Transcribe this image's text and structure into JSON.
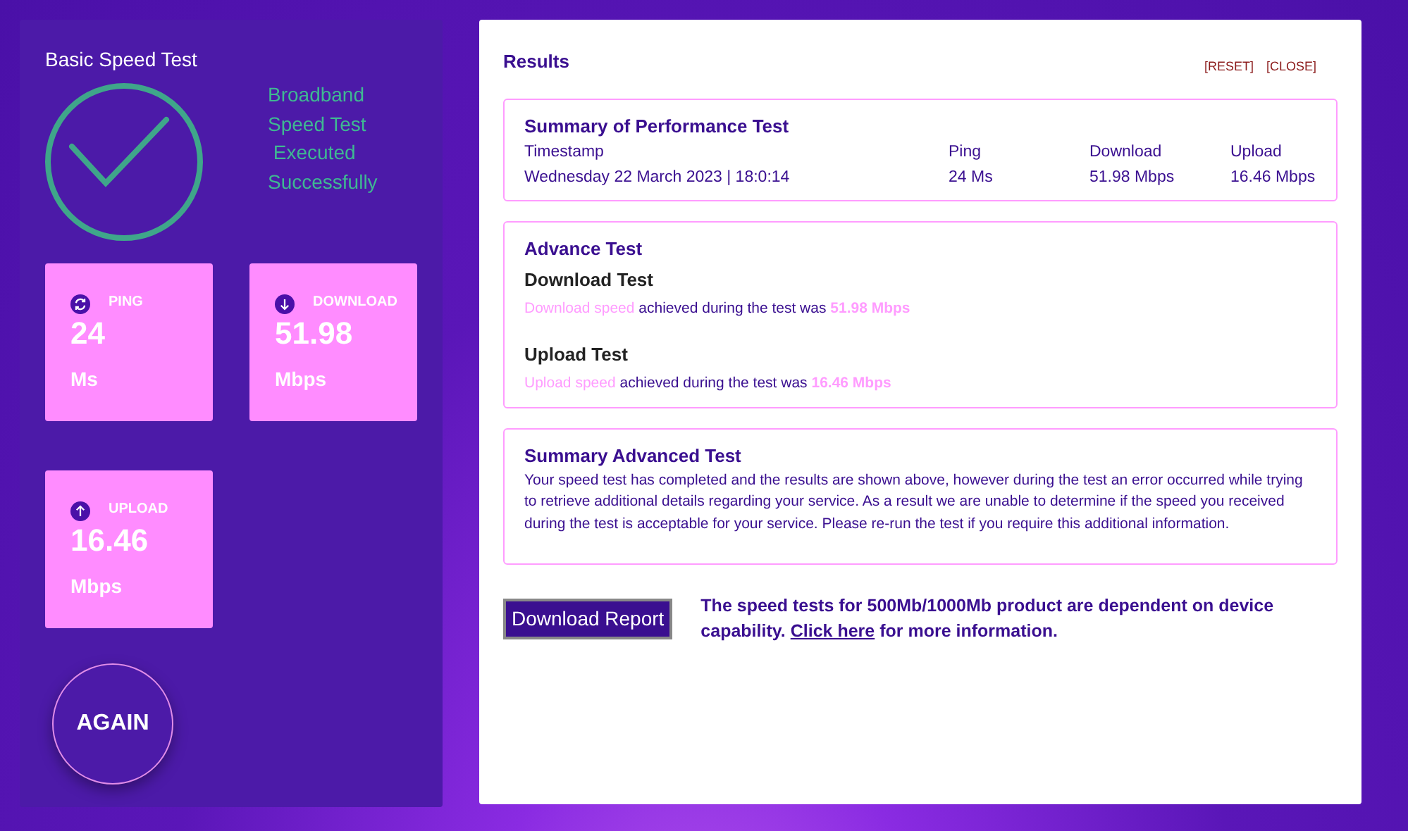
{
  "basic": {
    "title": "Basic Speed Test",
    "status_lines": [
      "Broadband",
      "Speed Test",
      " Executed",
      "Successfully"
    ],
    "stats": [
      {
        "kind": "ping",
        "label": "PING",
        "value": "24",
        "unit": "Ms"
      },
      {
        "kind": "download",
        "label": "DOWNLOAD",
        "value": "51.98",
        "unit": "Mbps"
      },
      {
        "kind": "upload",
        "label": "UPLOAD",
        "value": "16.46",
        "unit": "Mbps"
      }
    ],
    "again_button": "AGAIN"
  },
  "results": {
    "title": "Results",
    "links": [
      "[RESET]",
      "[CLOSE]"
    ],
    "summary": {
      "title": "Summary of Performance Test",
      "columns": [
        "Timestamp",
        "Ping",
        "Download",
        "Upload"
      ],
      "values": [
        "Wednesday 22 March 2023 | 18:0:14",
        "24 Ms",
        "51.98 Mbps",
        "16.46 Mbps"
      ]
    },
    "advance": {
      "title": "Advance Test",
      "tests": [
        {
          "title": "Download Test",
          "lead": "Download speed",
          "text": " achieved during the test was ",
          "value": "51.98 Mbps"
        },
        {
          "title": "Upload Test",
          "lead": "Upload speed",
          "text": " achieved during the test was ",
          "value": "16.46 Mbps"
        }
      ]
    },
    "advanced_summary": {
      "title": "Summary Advanced Test",
      "text": "Your speed test has completed and the results are shown above, however during the test an error occurred while trying to retrieve additional details regarding your service. As a result we are unable to determine if the speed you received during the test is acceptable for your service. Please re-run the test if you require this additional information."
    },
    "report_button": "Download Report",
    "notice": {
      "before": "The speed tests for 500Mb/1000Mb product are dependent on device capability. ",
      "link": "Click here",
      "after": " for more information."
    }
  }
}
